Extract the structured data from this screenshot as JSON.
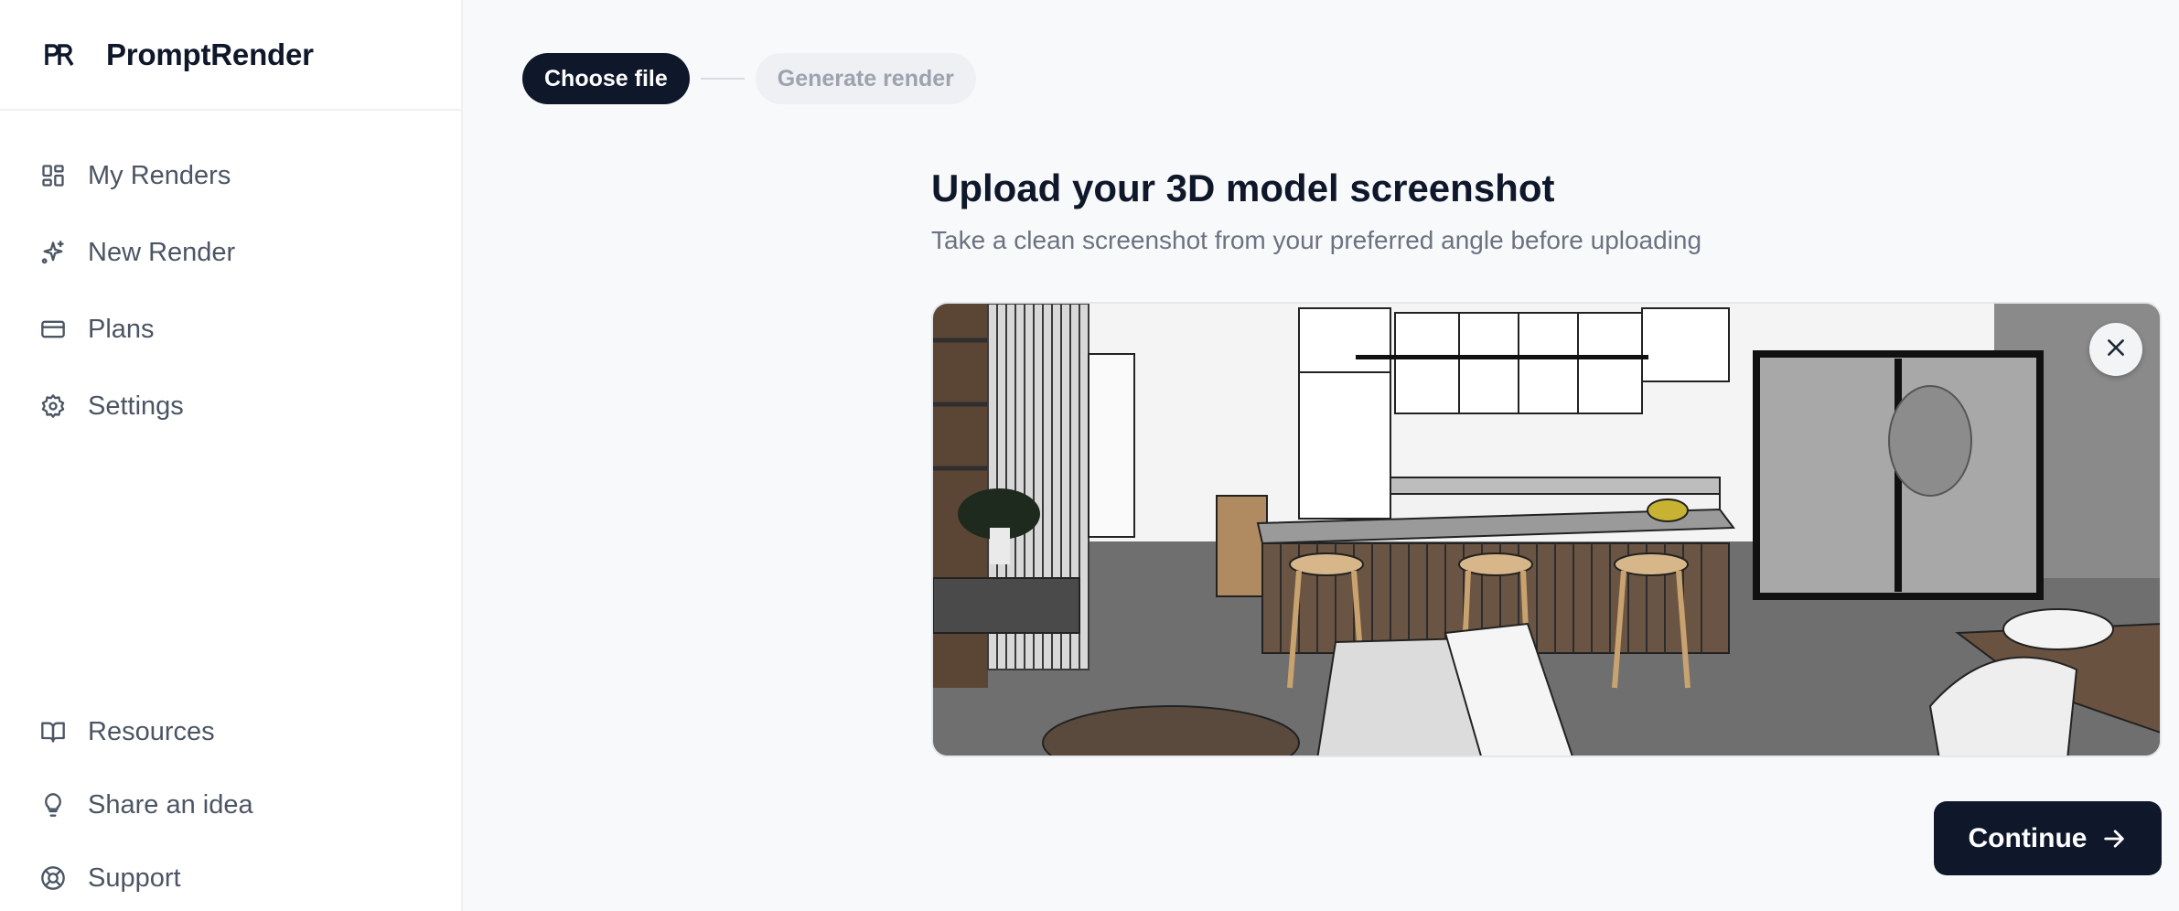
{
  "app": {
    "name": "PromptRender",
    "logo_icon": "pr-logo-icon"
  },
  "sidebar": {
    "top_items": [
      {
        "label": "My Renders",
        "icon": "grid-icon"
      },
      {
        "label": "New Render",
        "icon": "sparkles-icon"
      },
      {
        "label": "Plans",
        "icon": "credit-card-icon"
      },
      {
        "label": "Settings",
        "icon": "gear-icon"
      }
    ],
    "bottom_items": [
      {
        "label": "Resources",
        "icon": "book-icon"
      },
      {
        "label": "Share an idea",
        "icon": "lightbulb-icon"
      },
      {
        "label": "Support",
        "icon": "lifebuoy-icon"
      }
    ]
  },
  "stepper": {
    "step1": "Choose file",
    "step2": "Generate render"
  },
  "upload": {
    "title": "Upload your 3D model screenshot",
    "subtitle": "Take a clean screenshot from your preferred angle before uploading",
    "preview_image": "kitchen-3d-model-screenshot",
    "remove_icon": "close-icon"
  },
  "actions": {
    "continue_label": "Continue",
    "continue_icon": "arrow-right-icon"
  },
  "colors": {
    "primary": "#0f172a",
    "background": "#f8f9fb",
    "muted_text": "#6b7280"
  }
}
